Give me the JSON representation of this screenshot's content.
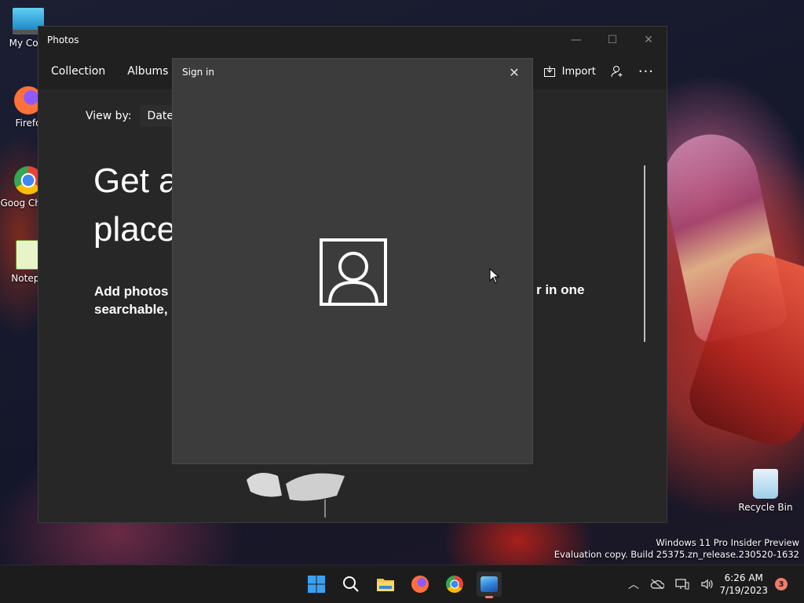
{
  "desktop": {
    "icons": [
      {
        "label": "My Com",
        "icon": "monitor-icon"
      },
      {
        "label": "Firefo",
        "icon": "firefox-icon"
      },
      {
        "label": "Goog Chron",
        "icon": "chrome-icon"
      },
      {
        "label": "Notepa",
        "icon": "notepad-icon"
      },
      {
        "label": "Recycle Bin",
        "icon": "recycle-bin-icon"
      }
    ]
  },
  "photos_window": {
    "title": "Photos",
    "tabs": [
      "Collection",
      "Albums"
    ],
    "import_label": "Import",
    "view_by_label": "View by:",
    "view_by_value": "Date ta",
    "hero_line1": "Get a",
    "hero_line2": "place",
    "sub_line1": "Add photos",
    "sub_line2": "searchable, s",
    "sub_right": "r in one"
  },
  "dialog": {
    "title": "Sign in",
    "close_glyph": "✕"
  },
  "watermark": {
    "line1": "Windows 11 Pro Insider Preview",
    "line2": "Evaluation copy. Build 25375.zn_release.230520-1632"
  },
  "taskbar": {
    "time": "6:26 AM",
    "date": "7/19/2023",
    "notification_count": "3"
  },
  "colors": {
    "accent": "#f07c6b",
    "window_bg": "#202020",
    "dialog_bg": "#3c3c3c"
  }
}
